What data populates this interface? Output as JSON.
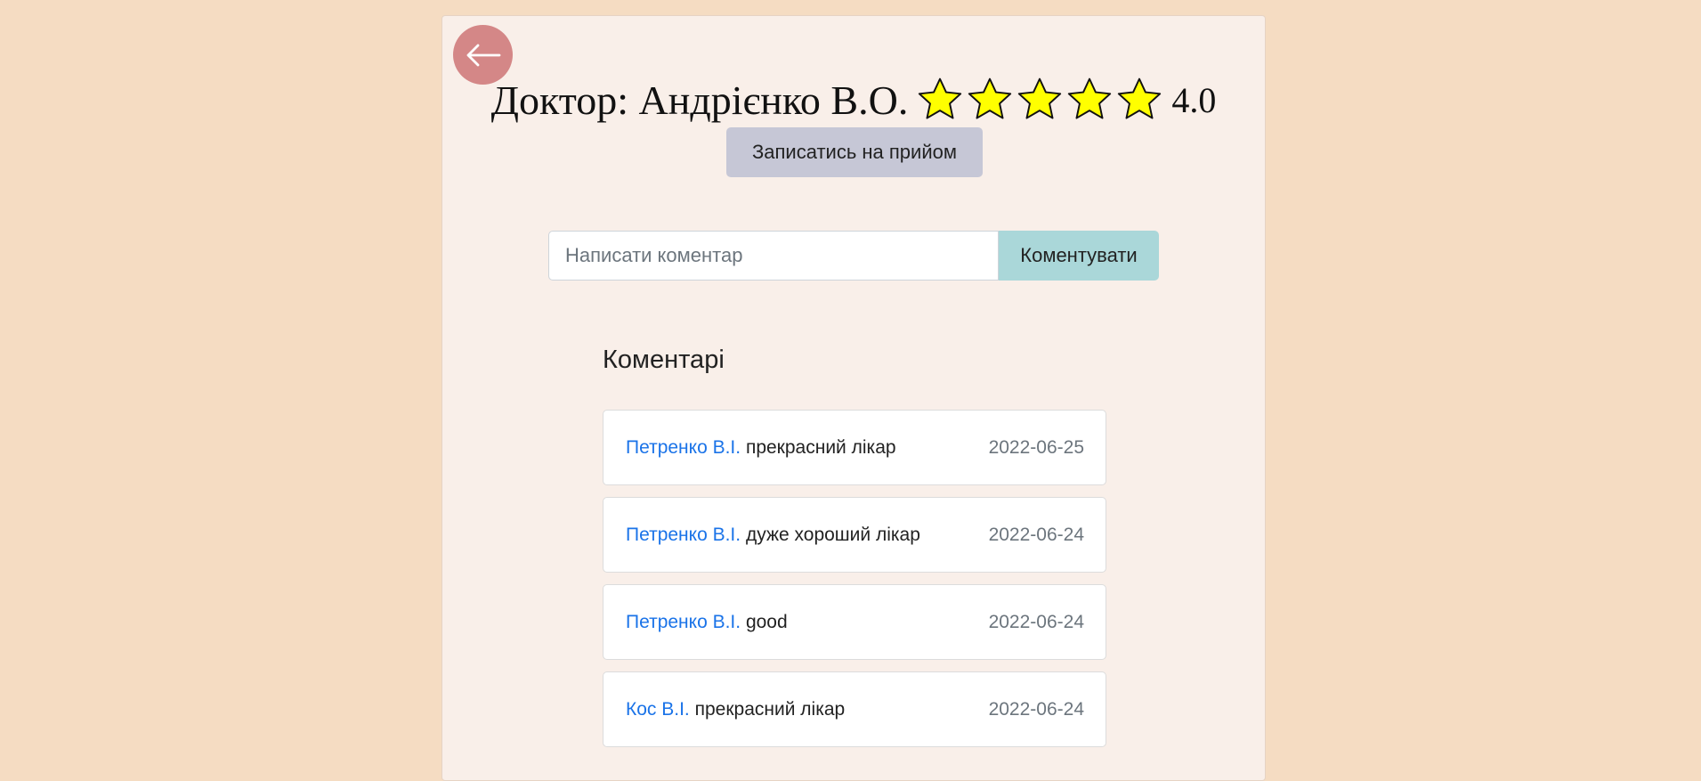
{
  "doctor": {
    "title": "Доктор: Андрієнко В.О.",
    "rating_value": "4.0",
    "rating": 4.0,
    "rating_max": 5,
    "star_color": "#ffff00"
  },
  "buttons": {
    "back_icon": "arrow-left-icon",
    "book_label": "Записатись на прийом",
    "comment_label": "Коментувати"
  },
  "comment_form": {
    "placeholder": "Написати коментар",
    "value": ""
  },
  "comments": {
    "heading": "Коментарі",
    "items": [
      {
        "author": "Петренко В.І.",
        "text": "прекрасний лікар",
        "date": "2022-06-25"
      },
      {
        "author": "Петренко В.І.",
        "text": "дуже хороший лікар",
        "date": "2022-06-24"
      },
      {
        "author": "Петренко В.І.",
        "text": "good",
        "date": "2022-06-24"
      },
      {
        "author": "Кос В.І.",
        "text": "прекрасний лікар",
        "date": "2022-06-24"
      }
    ]
  },
  "colors": {
    "page_background": "#f5dcc2",
    "card_background": "#f9efe9",
    "back_button": "#d48787",
    "book_button": "#c6c7d6",
    "comment_button": "#aad7d9",
    "author_link": "#1a73e8"
  }
}
